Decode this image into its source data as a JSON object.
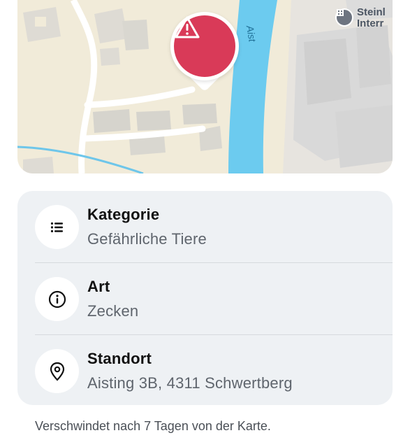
{
  "map": {
    "river_label": "Aist",
    "poi": {
      "line1": "Steinl",
      "line2": "Interr",
      "icon": "building-icon"
    },
    "pin": {
      "icon": "warning-triangle-icon",
      "color": "#d93a58"
    }
  },
  "details": {
    "rows": [
      {
        "title": "Kategorie",
        "value": "Gefährliche Tiere",
        "icon": "list-icon"
      },
      {
        "title": "Art",
        "value": "Zecken",
        "icon": "info-icon"
      },
      {
        "title": "Standort",
        "value": "Aisting 3B, 4311 Schwertberg",
        "icon": "location-pin-icon"
      }
    ]
  },
  "footer": {
    "note": "Verschwindet nach 7 Tagen von der Karte."
  }
}
